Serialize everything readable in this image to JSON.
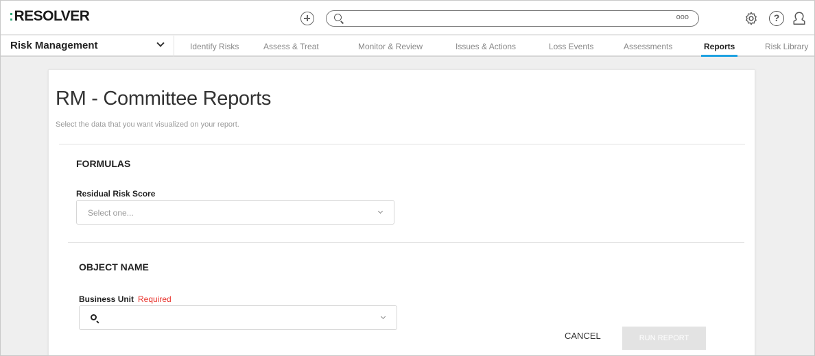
{
  "header": {
    "logo_colon": ":",
    "logo_text": "RESOLVER",
    "search_placeholder": "",
    "search_more": "ooo",
    "help_glyph": "?"
  },
  "icons": {
    "add": "plus-circle-icon",
    "search": "search-icon",
    "more": "more-dots-icon",
    "settings": "gear-icon",
    "help": "help-icon",
    "user": "user-icon",
    "dropdown": "chevron-down-icon"
  },
  "nav": {
    "app_name": "Risk Management",
    "tabs": [
      {
        "label": "Identify Risks",
        "active": false
      },
      {
        "label": "Assess & Treat",
        "active": false
      },
      {
        "label": "Monitor & Review",
        "active": false
      },
      {
        "label": "Issues & Actions",
        "active": false
      },
      {
        "label": "Loss Events",
        "active": false
      },
      {
        "label": "Assessments",
        "active": false
      },
      {
        "label": "Reports",
        "active": true
      },
      {
        "label": "Risk Library",
        "active": false
      }
    ]
  },
  "page": {
    "title": "RM - Committee Reports",
    "subtitle": "Select the data that you want visualized on your report."
  },
  "sections": {
    "formulas": {
      "heading": "FORMULAS",
      "field_label": "Residual Risk Score",
      "placeholder": "Select one..."
    },
    "object_name": {
      "heading": "OBJECT NAME",
      "field_label": "Business Unit",
      "required_label": "Required",
      "value": ""
    }
  },
  "actions": {
    "cancel": "CANCEL",
    "run": "RUN REPORT"
  },
  "colors": {
    "accent": "#1da1e1",
    "logo_accent": "#2aa876",
    "required": "#e8322b",
    "disabled_button": "#e3e3e3"
  }
}
